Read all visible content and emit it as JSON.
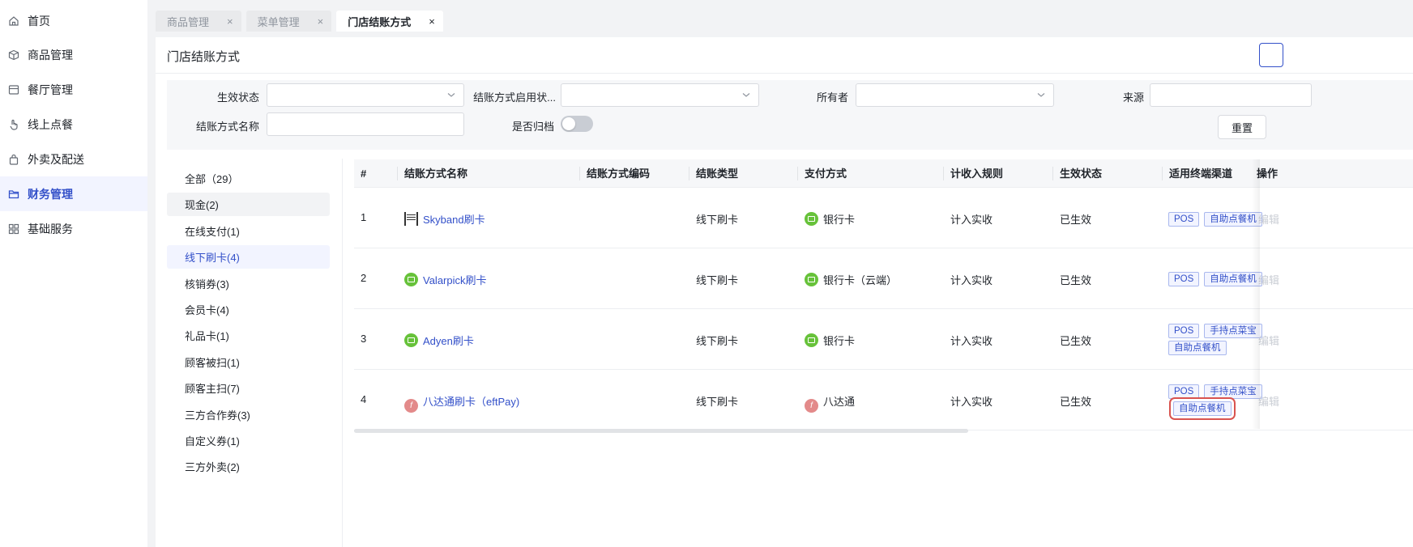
{
  "sidebar": {
    "items": [
      {
        "label": "首页",
        "icon": "home-icon"
      },
      {
        "label": "商品管理",
        "icon": "box-icon"
      },
      {
        "label": "餐厅管理",
        "icon": "store-icon"
      },
      {
        "label": "线上点餐",
        "icon": "hand-pointer-icon"
      },
      {
        "label": "外卖及配送",
        "icon": "bag-icon"
      },
      {
        "label": "财务管理",
        "icon": "folder-icon",
        "active": true
      },
      {
        "label": "基础服务",
        "icon": "grid-icon"
      }
    ]
  },
  "tabs": [
    {
      "label": "商品管理",
      "close": "×"
    },
    {
      "label": "菜单管理",
      "close": "×"
    },
    {
      "label": "门店结账方式",
      "close": "×",
      "active": true
    }
  ],
  "page": {
    "title": "门店结账方式"
  },
  "filters": {
    "effective_status_label": "生效状态",
    "enable_status_label": "结账方式启用状...",
    "owner_label": "所有者",
    "source_label": "来源",
    "name_label": "结账方式名称",
    "archived_label": "是否归档",
    "archived_value": false,
    "reset_label": "重置"
  },
  "categories": [
    {
      "label": "全部（29）"
    },
    {
      "label": "现金(2)",
      "state": "hover"
    },
    {
      "label": "在线支付(1)"
    },
    {
      "label": "线下刷卡(4)",
      "state": "active"
    },
    {
      "label": "核销券(3)"
    },
    {
      "label": "会员卡(4)"
    },
    {
      "label": "礼品卡(1)"
    },
    {
      "label": "顾客被扫(1)"
    },
    {
      "label": "顾客主扫(7)"
    },
    {
      "label": "三方合作券(3)"
    },
    {
      "label": "自定义券(1)"
    },
    {
      "label": "三方外卖(2)"
    }
  ],
  "table": {
    "columns": [
      "#",
      "结账方式名称",
      "结账方式编码",
      "结账类型",
      "支付方式",
      "计收入规则",
      "生效状态",
      "适用终端渠道",
      "操作"
    ],
    "rows": [
      {
        "num": "1",
        "name": "Skyband刷卡",
        "name_icon": "skyband-icon",
        "code": "",
        "type": "线下刷卡",
        "payment": "银行卡",
        "payment_icon": "bank-card-icon",
        "rule": "计入实收",
        "status": "已生效",
        "channels_line1": [
          "POS",
          "自助点餐机"
        ],
        "channels_line2": [],
        "op": "编辑"
      },
      {
        "num": "2",
        "name": "Valarpick刷卡",
        "name_icon": "bank-card-icon",
        "code": "",
        "type": "线下刷卡",
        "payment": "银行卡（云端）",
        "payment_icon": "bank-card-icon",
        "rule": "计入实收",
        "status": "已生效",
        "channels_line1": [
          "POS",
          "自助点餐机"
        ],
        "channels_line2": [],
        "op": "编辑"
      },
      {
        "num": "3",
        "name": "Adyen刷卡",
        "name_icon": "bank-card-icon",
        "code": "",
        "type": "线下刷卡",
        "payment": "银行卡",
        "payment_icon": "bank-card-icon",
        "rule": "计入实收",
        "status": "已生效",
        "channels_line1": [
          "POS",
          "手持点菜宝"
        ],
        "channels_line2": [
          "自助点餐机"
        ],
        "op": "编辑"
      },
      {
        "num": "4",
        "name": "八达通刷卡（eftPay)",
        "name_icon": "octopus-icon",
        "code": "",
        "type": "线下刷卡",
        "payment": "八达通",
        "payment_icon": "octopus-icon",
        "rule": "计入实收",
        "status": "已生效",
        "channels_line1": [
          "POS",
          "手持点菜宝"
        ],
        "channels_line2": [
          "自助点餐机"
        ],
        "highlight_line2": true,
        "op": "编辑"
      }
    ]
  },
  "colors": {
    "accent": "#3350c9",
    "highlight": "#d9534f",
    "card_green": "#67c23a",
    "octopus_pink": "#e38a8a"
  }
}
